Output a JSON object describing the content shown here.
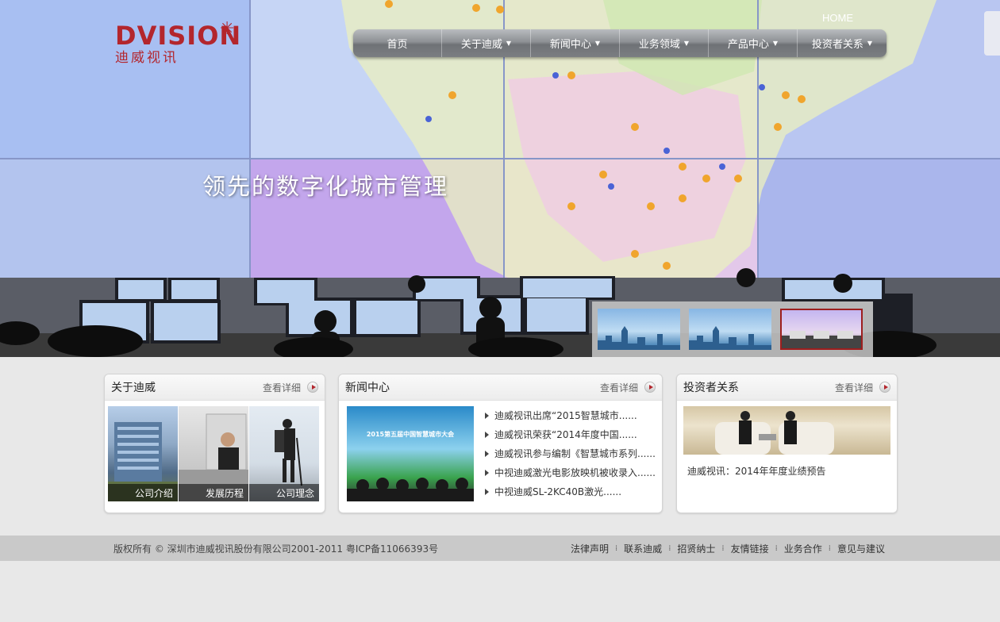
{
  "header": {
    "logo_text": "DVISION",
    "logo_sub": "迪威视讯",
    "home_label": "HOME"
  },
  "nav": {
    "items": [
      {
        "label": "首页",
        "has_dropdown": false
      },
      {
        "label": "关于迪威",
        "has_dropdown": true
      },
      {
        "label": "新闻中心",
        "has_dropdown": true
      },
      {
        "label": "业务领域",
        "has_dropdown": true
      },
      {
        "label": "产品中心",
        "has_dropdown": true
      },
      {
        "label": "投资者关系",
        "has_dropdown": true
      }
    ],
    "caret": "▼"
  },
  "hero": {
    "slogan": "领先的数字化城市管理",
    "active_slide": 3
  },
  "panels": {
    "more_label": "查看详细",
    "about": {
      "title": "关于迪威",
      "images": [
        {
          "caption": "公司介绍",
          "icon": "building-image"
        },
        {
          "caption": "发展历程",
          "icon": "office-image"
        },
        {
          "caption": "公司理念",
          "icon": "hiker-image"
        }
      ]
    },
    "news": {
      "title": "新闻中心",
      "image_banner": "2015第五届中国智慧城市大会",
      "items": [
        "迪威视讯出席“2015智慧城市......",
        "迪威视讯荣获“2014年度中国......",
        "迪威视讯参与编制《智慧城市系列......",
        "中视迪威激光电影放映机被收录入......",
        "中视迪威SL-2KC40B激光......"
      ]
    },
    "investor": {
      "title": "投资者关系",
      "headline": "迪威视讯：2014年年度业绩预告"
    }
  },
  "footer": {
    "copyright": "版权所有 © 深圳市迪威视讯股份有限公司2001-2011 粤ICP备11066393号",
    "separator": "⁞",
    "links": [
      "法律声明",
      "联系迪威",
      "招贤纳士",
      "友情链接",
      "业务合作",
      "意见与建议"
    ]
  },
  "colors": {
    "brand_red": "#b3262d",
    "footer_bg": "#c9c9c9",
    "page_bg": "#e8e8e8"
  }
}
